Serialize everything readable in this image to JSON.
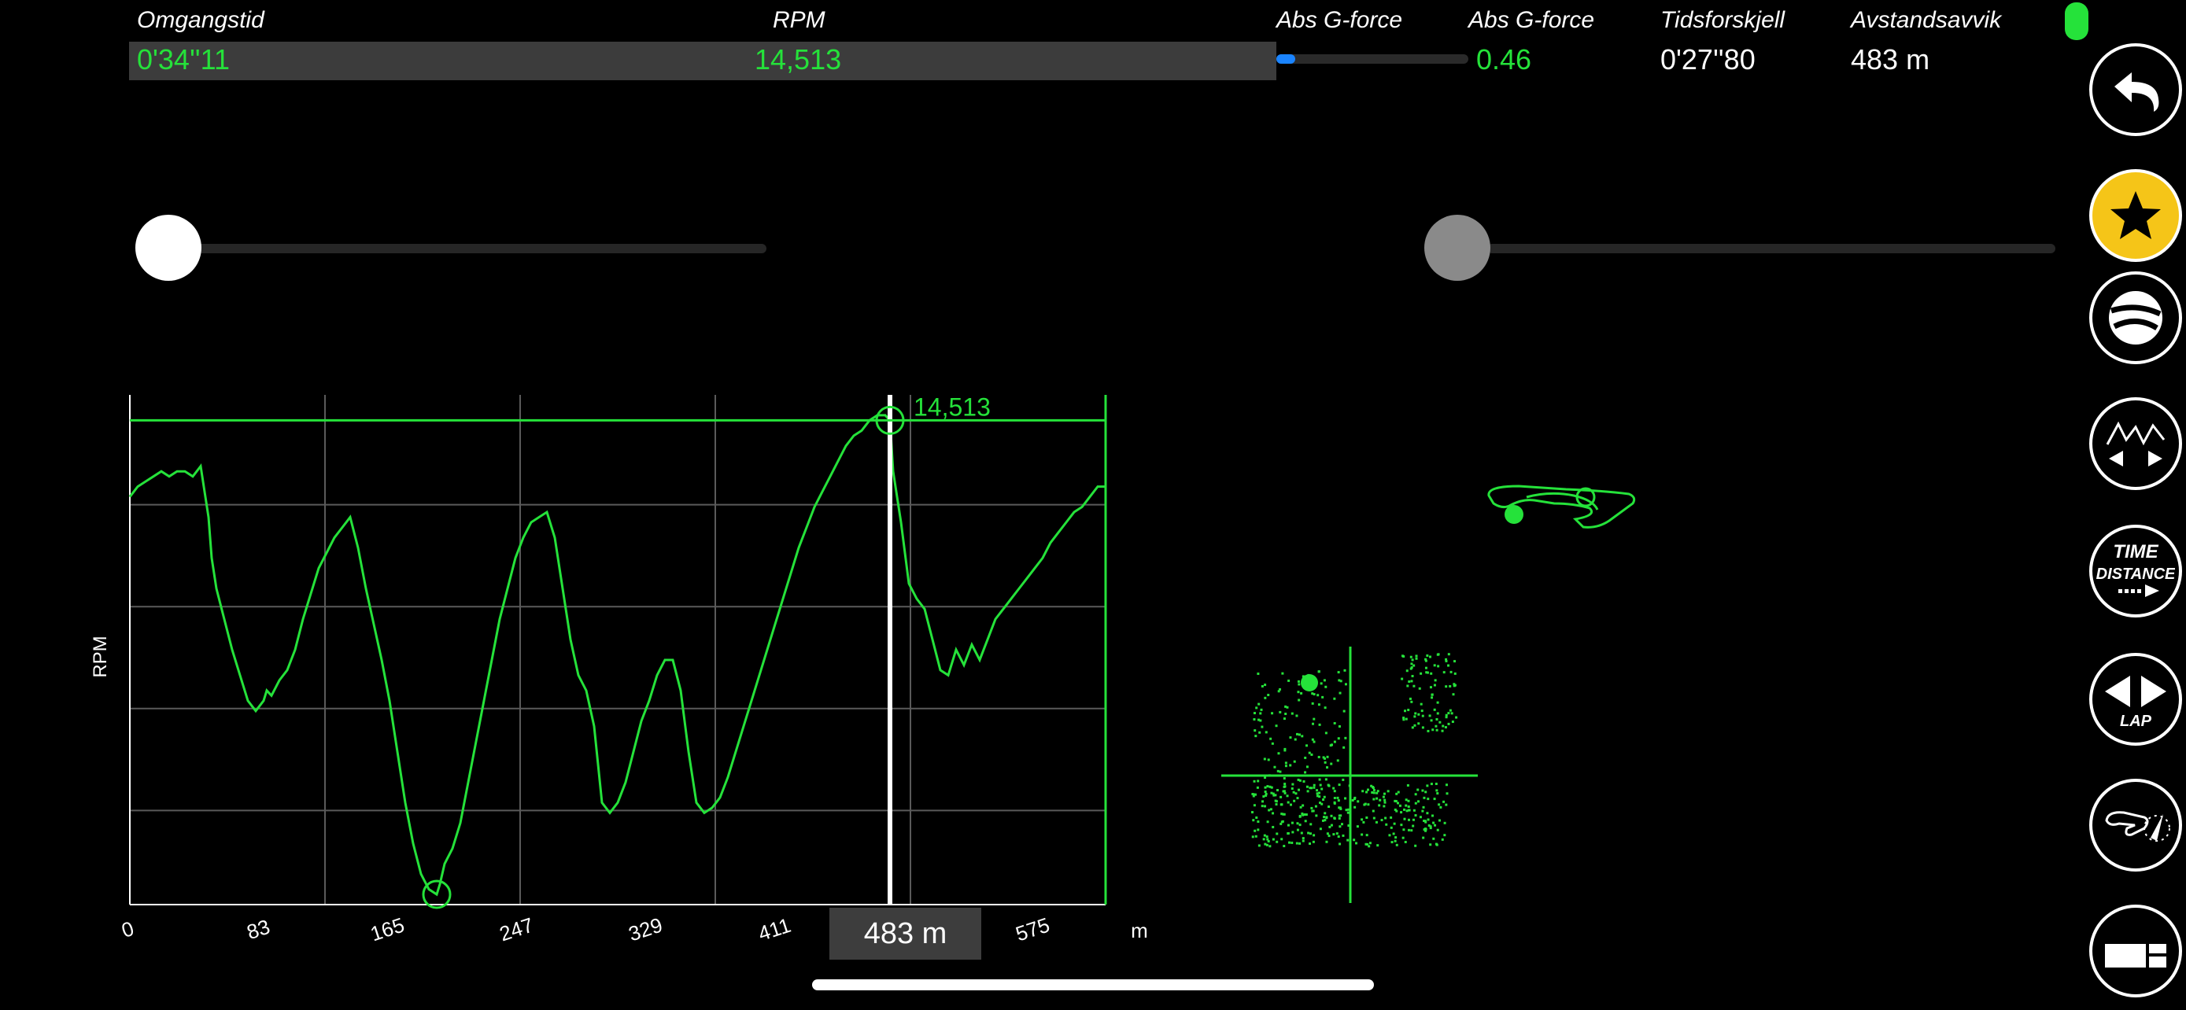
{
  "header": {
    "lap_time": {
      "label": "Omgangstid",
      "value": "0'34''11"
    },
    "rpm": {
      "label": "RPM",
      "value": "14,513"
    },
    "g_force_bar": {
      "label": "Abs G-force",
      "level": 0.1
    },
    "g_force": {
      "label": "Abs G-force",
      "value": "0.46"
    },
    "time_diff": {
      "label": "Tidsforskjell",
      "value": "0'27''80"
    },
    "distance_dev": {
      "label": "Avstandsavvik",
      "value": "483 m"
    }
  },
  "sliders": [
    {
      "name": "left-slider",
      "level": 0.0
    },
    {
      "name": "right-slider",
      "level": 0.0
    }
  ],
  "sidebar": {
    "buttons": [
      {
        "icon": "undo-icon"
      },
      {
        "icon": "star-icon"
      },
      {
        "icon": "globe-icon"
      },
      {
        "icon": "graph-compare-icon"
      },
      {
        "icon": "time-distance-icon",
        "line1": "TIME",
        "line2": "DISTANCE"
      },
      {
        "icon": "lap-arrows-icon",
        "label": "LAP"
      },
      {
        "icon": "track-compass-icon"
      },
      {
        "icon": "layout-icon"
      }
    ]
  },
  "position_badge": "483 m",
  "colors": {
    "line": "#25e23a",
    "accent": "#1a84ff",
    "star": "#f5c518",
    "grid": "#5a5a5a"
  },
  "chart_data": {
    "type": "line",
    "ylabel": "RPM",
    "xlabel": "m",
    "xlim": [
      0,
      620
    ],
    "x_ticks": [
      0,
      83,
      165,
      247,
      329,
      411,
      575
    ],
    "cursor_x": 483,
    "cursor_label": "14,513",
    "ylim": [
      0,
      100
    ],
    "series": [
      {
        "x": [
          0,
          5,
          10,
          15,
          20,
          25,
          30,
          35,
          40,
          45,
          50,
          52,
          55,
          60,
          65,
          70,
          75,
          80,
          85,
          87,
          90,
          95,
          100,
          105,
          110,
          115,
          120,
          125,
          130,
          135,
          140,
          145,
          150,
          155,
          160,
          165,
          170,
          175,
          180,
          185,
          190,
          195,
          197,
          200,
          205,
          210,
          215,
          220,
          225,
          230,
          235,
          240,
          245,
          250,
          255,
          260,
          265,
          270,
          275,
          280,
          285,
          290,
          295,
          300,
          305,
          310,
          315,
          320,
          325,
          330,
          335,
          340,
          345,
          350,
          355,
          360,
          365,
          370,
          375,
          380,
          385,
          390,
          395,
          400,
          405,
          410,
          415,
          420,
          425,
          430,
          435,
          440,
          445,
          450,
          455,
          460,
          465,
          470,
          475,
          480,
          483,
          485,
          490,
          495,
          500,
          505,
          510,
          515,
          520,
          525,
          530,
          535,
          540,
          545,
          550,
          555,
          560,
          565,
          570,
          575,
          580,
          585,
          590,
          595,
          600,
          605,
          610,
          615,
          620
        ],
        "y": [
          80,
          82,
          83,
          84,
          85,
          84,
          85,
          85,
          84,
          86,
          76,
          68,
          62,
          56,
          50,
          45,
          40,
          38,
          40,
          42,
          41,
          44,
          46,
          50,
          56,
          61,
          66,
          69,
          72,
          74,
          76,
          70,
          62,
          55,
          48,
          40,
          30,
          20,
          12,
          6,
          3,
          2,
          4,
          8,
          11,
          16,
          24,
          32,
          40,
          48,
          56,
          62,
          68,
          72,
          75,
          76,
          77,
          72,
          62,
          52,
          45,
          42,
          35,
          20,
          18,
          20,
          24,
          30,
          36,
          40,
          45,
          48,
          48,
          42,
          30,
          20,
          18,
          19,
          21,
          25,
          30,
          35,
          40,
          45,
          50,
          55,
          60,
          65,
          70,
          74,
          78,
          81,
          84,
          87,
          90,
          92,
          93,
          95,
          96,
          96,
          95,
          85,
          75,
          63,
          60,
          58,
          52,
          46,
          45,
          50,
          47,
          51,
          48,
          52,
          56,
          58,
          60,
          62,
          64,
          66,
          68,
          71,
          73,
          75,
          77,
          78,
          80,
          82,
          82
        ]
      }
    ]
  }
}
